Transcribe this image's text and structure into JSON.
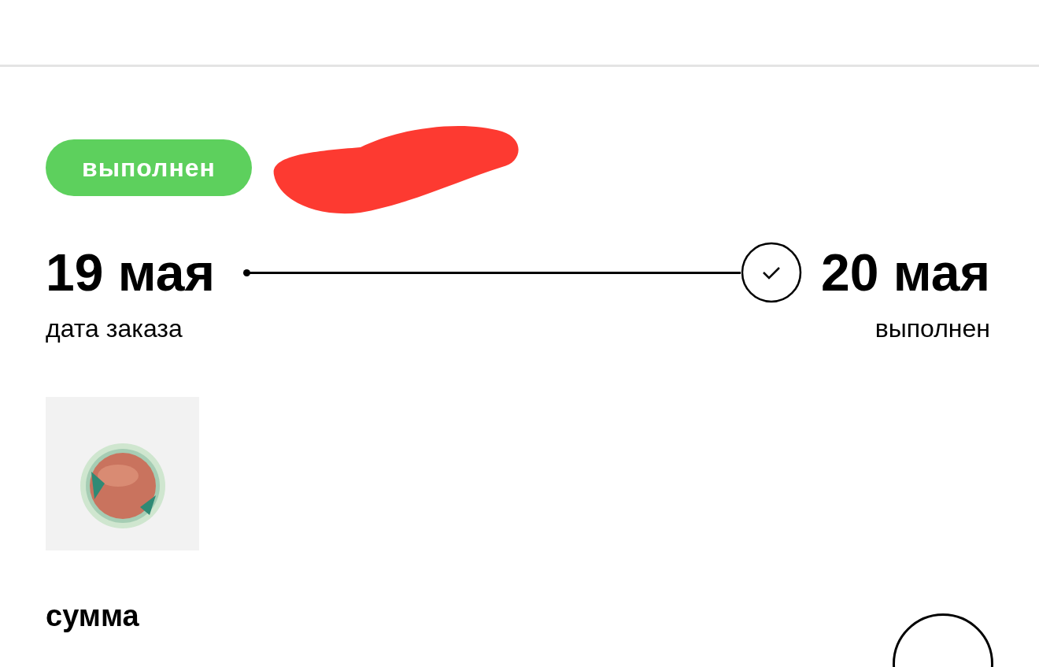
{
  "order": {
    "status": "выполнен",
    "completed": true
  },
  "timeline": {
    "start_date": "19 мая",
    "start_label": "дата заказа",
    "end_date": "20 мая",
    "end_label": "выполнен",
    "completed": true
  },
  "summary": {
    "title": "сумма"
  }
}
